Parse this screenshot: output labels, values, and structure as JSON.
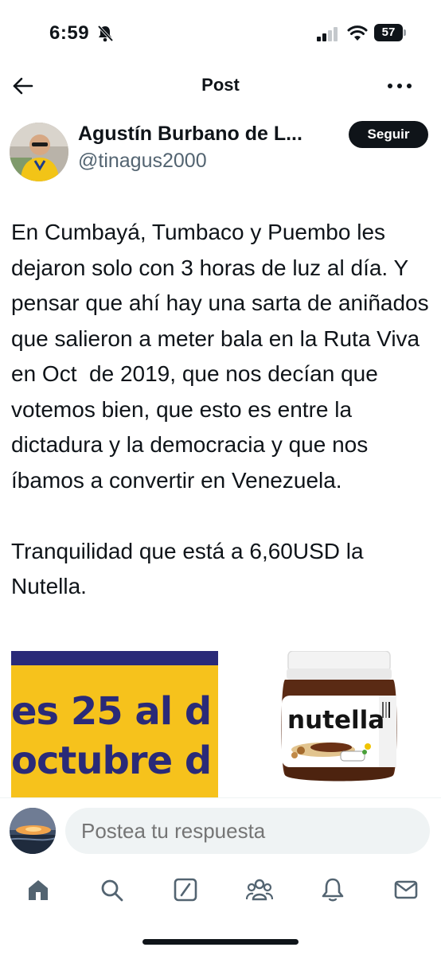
{
  "status_bar": {
    "time": "6:59",
    "battery": "57"
  },
  "header": {
    "title": "Post"
  },
  "author": {
    "name": "Agustín Burbano de L...",
    "handle": "@tinagus2000",
    "follow_label": "Seguir"
  },
  "post": {
    "text": "En Cumbayá, Tumbaco y Puembo les dejaron solo con 3 horas de luz al día. Y pensar que ahí hay una sarta de aniñados que salieron a meter bala en la Ruta Viva en Oct  de 2019, que nos decían que votemos bien, que esto es entre la dictadura y la democracia y que nos íbamos a convertir en Venezuela.\n\nTranquilidad que está a 6,60USD la Nutella."
  },
  "media": {
    "left_line1": "es 25 al d",
    "left_line2": "octubre d",
    "nutella_brand": "nutella"
  },
  "reply": {
    "placeholder": "Postea tu respuesta"
  },
  "bottom_nav": {
    "items": [
      "home-icon",
      "search-icon",
      "grok-icon",
      "communities-icon",
      "notifications-icon",
      "messages-icon"
    ]
  },
  "colors": {
    "text": "#0f1419",
    "secondary": "#536471",
    "banner_yellow": "#f6c21c",
    "banner_navy": "#2a2a78"
  }
}
